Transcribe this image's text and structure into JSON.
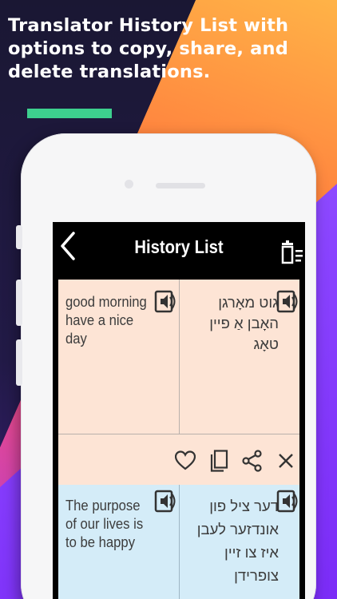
{
  "headline": "Translator History List with options to copy, share, and delete translations.",
  "colors": {
    "accent_bar": "#3dcf8e",
    "card_peach": "#fde4d5",
    "card_blue": "#d4ecf8",
    "appbar": "#000000"
  },
  "app": {
    "title": "History List",
    "back_icon": "chevron-left-icon",
    "delete_all_icon": "trash-list-icon"
  },
  "history": [
    {
      "source_text": "good morning have a nice day",
      "target_text": "גוט מאָרגן האָבן אַ פיין טאָג",
      "actions": [
        "heart-icon",
        "copy-icon",
        "share-icon",
        "close-icon"
      ]
    },
    {
      "source_text": "The purpose of our lives is to be happy",
      "target_text": "דער ציל פון אונדזער לעבן איז צו זיין צופרידן"
    }
  ]
}
